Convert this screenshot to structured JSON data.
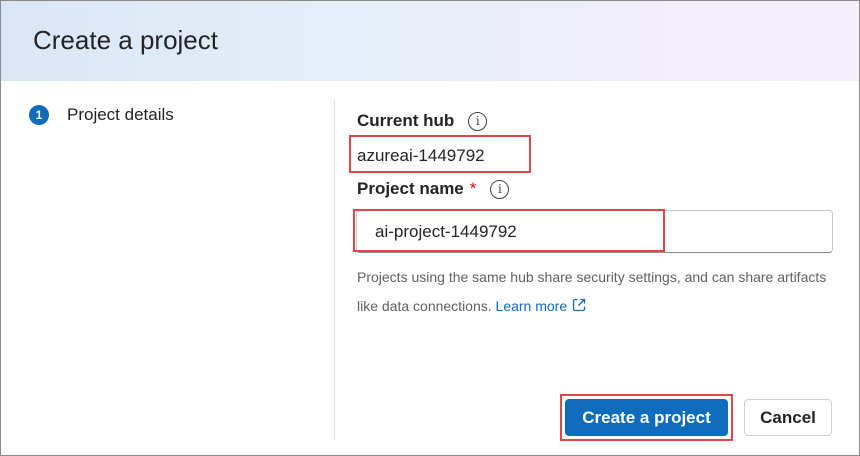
{
  "dialog": {
    "title": "Create a project"
  },
  "steps": [
    {
      "number": "1",
      "label": "Project details"
    }
  ],
  "form": {
    "current_hub": {
      "label": "Current hub",
      "info_icon": "info-icon",
      "value": "azureai-1449792"
    },
    "project_name": {
      "label": "Project name",
      "required_mark": "*",
      "info_icon": "info-icon",
      "value": "ai-project-1449792"
    },
    "helper_text": "Projects using the same hub share security settings, and can share artifacts like data connections.",
    "learn_more": "Learn more",
    "learn_more_icon": "external-link-icon"
  },
  "actions": {
    "create_label": "Create a project",
    "cancel_label": "Cancel"
  },
  "colors": {
    "accent": "#0f6cbd",
    "highlight_box": "#e0474c",
    "required": "#c50f1f"
  }
}
